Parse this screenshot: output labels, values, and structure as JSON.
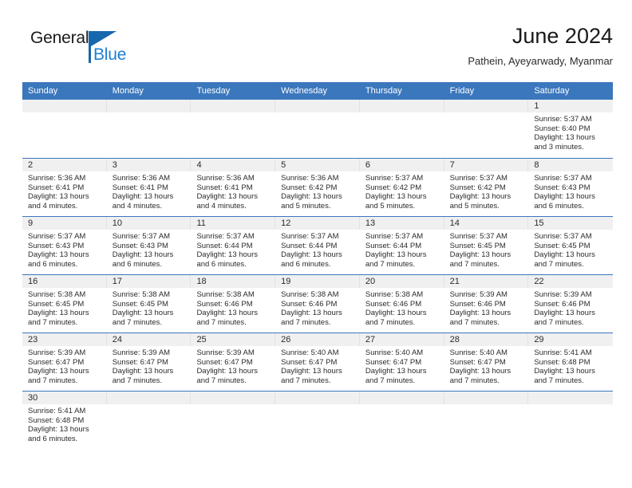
{
  "brand": {
    "name_part1": "General",
    "name_part2": "Blue",
    "flag_color": "#1767ad",
    "blue_color": "#1e7fd4"
  },
  "header": {
    "title": "June 2024",
    "location": "Pathein, Ayeyarwady, Myanmar"
  },
  "theme": {
    "header_blue": "#3b77bd",
    "day_band_gray": "#f0f0f0",
    "text_color": "#2b2b2b"
  },
  "weekdays": [
    "Sunday",
    "Monday",
    "Tuesday",
    "Wednesday",
    "Thursday",
    "Friday",
    "Saturday"
  ],
  "weeks": [
    [
      {
        "day": "",
        "empty": true
      },
      {
        "day": "",
        "empty": true
      },
      {
        "day": "",
        "empty": true
      },
      {
        "day": "",
        "empty": true
      },
      {
        "day": "",
        "empty": true
      },
      {
        "day": "",
        "empty": true
      },
      {
        "day": "1",
        "sunrise": "Sunrise: 5:37 AM",
        "sunset": "Sunset: 6:40 PM",
        "daylight1": "Daylight: 13 hours",
        "daylight2": "and 3 minutes."
      }
    ],
    [
      {
        "day": "2",
        "sunrise": "Sunrise: 5:36 AM",
        "sunset": "Sunset: 6:41 PM",
        "daylight1": "Daylight: 13 hours",
        "daylight2": "and 4 minutes."
      },
      {
        "day": "3",
        "sunrise": "Sunrise: 5:36 AM",
        "sunset": "Sunset: 6:41 PM",
        "daylight1": "Daylight: 13 hours",
        "daylight2": "and 4 minutes."
      },
      {
        "day": "4",
        "sunrise": "Sunrise: 5:36 AM",
        "sunset": "Sunset: 6:41 PM",
        "daylight1": "Daylight: 13 hours",
        "daylight2": "and 4 minutes."
      },
      {
        "day": "5",
        "sunrise": "Sunrise: 5:36 AM",
        "sunset": "Sunset: 6:42 PM",
        "daylight1": "Daylight: 13 hours",
        "daylight2": "and 5 minutes."
      },
      {
        "day": "6",
        "sunrise": "Sunrise: 5:37 AM",
        "sunset": "Sunset: 6:42 PM",
        "daylight1": "Daylight: 13 hours",
        "daylight2": "and 5 minutes."
      },
      {
        "day": "7",
        "sunrise": "Sunrise: 5:37 AM",
        "sunset": "Sunset: 6:42 PM",
        "daylight1": "Daylight: 13 hours",
        "daylight2": "and 5 minutes."
      },
      {
        "day": "8",
        "sunrise": "Sunrise: 5:37 AM",
        "sunset": "Sunset: 6:43 PM",
        "daylight1": "Daylight: 13 hours",
        "daylight2": "and 6 minutes."
      }
    ],
    [
      {
        "day": "9",
        "sunrise": "Sunrise: 5:37 AM",
        "sunset": "Sunset: 6:43 PM",
        "daylight1": "Daylight: 13 hours",
        "daylight2": "and 6 minutes."
      },
      {
        "day": "10",
        "sunrise": "Sunrise: 5:37 AM",
        "sunset": "Sunset: 6:43 PM",
        "daylight1": "Daylight: 13 hours",
        "daylight2": "and 6 minutes."
      },
      {
        "day": "11",
        "sunrise": "Sunrise: 5:37 AM",
        "sunset": "Sunset: 6:44 PM",
        "daylight1": "Daylight: 13 hours",
        "daylight2": "and 6 minutes."
      },
      {
        "day": "12",
        "sunrise": "Sunrise: 5:37 AM",
        "sunset": "Sunset: 6:44 PM",
        "daylight1": "Daylight: 13 hours",
        "daylight2": "and 6 minutes."
      },
      {
        "day": "13",
        "sunrise": "Sunrise: 5:37 AM",
        "sunset": "Sunset: 6:44 PM",
        "daylight1": "Daylight: 13 hours",
        "daylight2": "and 7 minutes."
      },
      {
        "day": "14",
        "sunrise": "Sunrise: 5:37 AM",
        "sunset": "Sunset: 6:45 PM",
        "daylight1": "Daylight: 13 hours",
        "daylight2": "and 7 minutes."
      },
      {
        "day": "15",
        "sunrise": "Sunrise: 5:37 AM",
        "sunset": "Sunset: 6:45 PM",
        "daylight1": "Daylight: 13 hours",
        "daylight2": "and 7 minutes."
      }
    ],
    [
      {
        "day": "16",
        "sunrise": "Sunrise: 5:38 AM",
        "sunset": "Sunset: 6:45 PM",
        "daylight1": "Daylight: 13 hours",
        "daylight2": "and 7 minutes."
      },
      {
        "day": "17",
        "sunrise": "Sunrise: 5:38 AM",
        "sunset": "Sunset: 6:45 PM",
        "daylight1": "Daylight: 13 hours",
        "daylight2": "and 7 minutes."
      },
      {
        "day": "18",
        "sunrise": "Sunrise: 5:38 AM",
        "sunset": "Sunset: 6:46 PM",
        "daylight1": "Daylight: 13 hours",
        "daylight2": "and 7 minutes."
      },
      {
        "day": "19",
        "sunrise": "Sunrise: 5:38 AM",
        "sunset": "Sunset: 6:46 PM",
        "daylight1": "Daylight: 13 hours",
        "daylight2": "and 7 minutes."
      },
      {
        "day": "20",
        "sunrise": "Sunrise: 5:38 AM",
        "sunset": "Sunset: 6:46 PM",
        "daylight1": "Daylight: 13 hours",
        "daylight2": "and 7 minutes."
      },
      {
        "day": "21",
        "sunrise": "Sunrise: 5:39 AM",
        "sunset": "Sunset: 6:46 PM",
        "daylight1": "Daylight: 13 hours",
        "daylight2": "and 7 minutes."
      },
      {
        "day": "22",
        "sunrise": "Sunrise: 5:39 AM",
        "sunset": "Sunset: 6:46 PM",
        "daylight1": "Daylight: 13 hours",
        "daylight2": "and 7 minutes."
      }
    ],
    [
      {
        "day": "23",
        "sunrise": "Sunrise: 5:39 AM",
        "sunset": "Sunset: 6:47 PM",
        "daylight1": "Daylight: 13 hours",
        "daylight2": "and 7 minutes."
      },
      {
        "day": "24",
        "sunrise": "Sunrise: 5:39 AM",
        "sunset": "Sunset: 6:47 PM",
        "daylight1": "Daylight: 13 hours",
        "daylight2": "and 7 minutes."
      },
      {
        "day": "25",
        "sunrise": "Sunrise: 5:39 AM",
        "sunset": "Sunset: 6:47 PM",
        "daylight1": "Daylight: 13 hours",
        "daylight2": "and 7 minutes."
      },
      {
        "day": "26",
        "sunrise": "Sunrise: 5:40 AM",
        "sunset": "Sunset: 6:47 PM",
        "daylight1": "Daylight: 13 hours",
        "daylight2": "and 7 minutes."
      },
      {
        "day": "27",
        "sunrise": "Sunrise: 5:40 AM",
        "sunset": "Sunset: 6:47 PM",
        "daylight1": "Daylight: 13 hours",
        "daylight2": "and 7 minutes."
      },
      {
        "day": "28",
        "sunrise": "Sunrise: 5:40 AM",
        "sunset": "Sunset: 6:47 PM",
        "daylight1": "Daylight: 13 hours",
        "daylight2": "and 7 minutes."
      },
      {
        "day": "29",
        "sunrise": "Sunrise: 5:41 AM",
        "sunset": "Sunset: 6:48 PM",
        "daylight1": "Daylight: 13 hours",
        "daylight2": "and 7 minutes."
      }
    ],
    [
      {
        "day": "30",
        "sunrise": "Sunrise: 5:41 AM",
        "sunset": "Sunset: 6:48 PM",
        "daylight1": "Daylight: 13 hours",
        "daylight2": "and 6 minutes."
      },
      {
        "day": "",
        "empty": true
      },
      {
        "day": "",
        "empty": true
      },
      {
        "day": "",
        "empty": true
      },
      {
        "day": "",
        "empty": true
      },
      {
        "day": "",
        "empty": true
      },
      {
        "day": "",
        "empty": true
      }
    ]
  ]
}
